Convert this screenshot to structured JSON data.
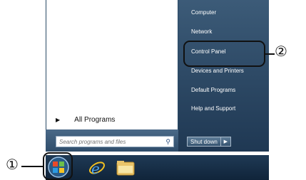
{
  "start_menu": {
    "all_programs_label": "All Programs",
    "search_placeholder": "Search programs and files",
    "right_items": [
      "Computer",
      "Network",
      "Control Panel",
      "Devices and Printers",
      "Default Programs",
      "Help and Support"
    ],
    "shutdown_label": "Shut down"
  },
  "callouts": {
    "one": "①",
    "two": "②"
  },
  "colors": {
    "menu_right": "#2f4d6b",
    "taskbar": "#14293f",
    "callout_stroke": "#111111"
  },
  "icons": {
    "start": "windows-start-orb-icon",
    "browser": "internet-explorer-icon",
    "folder": "windows-explorer-folder-icon",
    "search": "magnifier-icon",
    "arrow": "triangle-right-icon"
  }
}
